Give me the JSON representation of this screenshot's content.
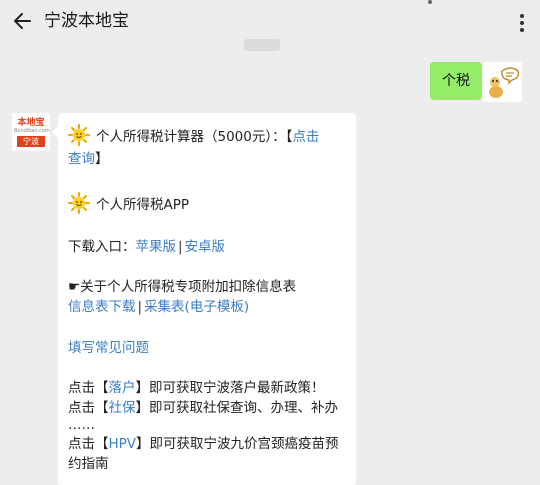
{
  "header": {
    "title": "宁波本地宝"
  },
  "outgoing": {
    "text": "个税"
  },
  "account": {
    "logo_name": "本地宝",
    "logo_domain": "Bendibao.com",
    "logo_city": "宁波"
  },
  "message": {
    "line1": {
      "prefix": "个人所得税计算器（5000元）：【",
      "link_part1": "点击",
      "link_part2": "查询",
      "suffix": "】"
    },
    "line2": "个人所得税APP",
    "download": {
      "label": "下载入口：",
      "apple": "苹果版",
      "sep": "|",
      "android": "安卓版"
    },
    "info_heading": "☛关于个人所得税专项附加扣除信息表",
    "info_links": {
      "download": "信息表下载",
      "sep": "|",
      "collect": "采集表(电子模板)"
    },
    "faq": "填写常见问题",
    "promo1": {
      "prefix": "点击【",
      "link": "落户",
      "suffix": "】即可获取宁波落户最新政策！"
    },
    "promo2": {
      "prefix": "点击【",
      "link": "社保",
      "suffix": "】即可获取社保查询、办理、补办"
    },
    "ellipsis": "……",
    "promo3": {
      "prefix": "点击【",
      "link": "HPV",
      "suffix": "】即可获取宁波九价宫颈癌疫苗预",
      "cont": "约指南"
    }
  },
  "colors": {
    "background": "#ededed",
    "outgoing_bubble": "#95ec69",
    "link": "#3a7ec4",
    "brand_red": "#e2401c"
  },
  "icons": [
    "back-arrow-icon",
    "more-dots-icon",
    "sun-emoji-icon",
    "pointing-hand-icon"
  ]
}
